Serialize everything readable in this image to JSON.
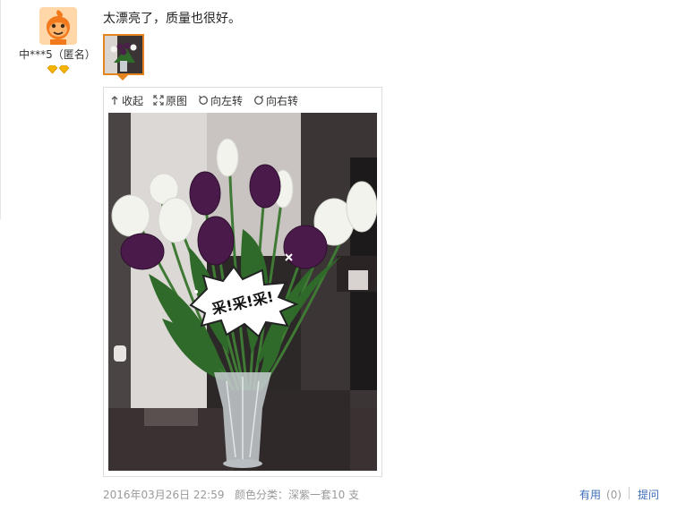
{
  "reviewer": {
    "name": "中***5（匿名）",
    "avatar_icon": "cartoon-face-icon",
    "level_badge_icon": "diamond-badge-icon"
  },
  "review": {
    "text": "太漂亮了，质量也很好。",
    "date": "2016年03月26日 22:59",
    "sku": "颜色分类：深紫一套10 支"
  },
  "viewer": {
    "collapse_label": "收起",
    "original_label": "原图",
    "rotate_left_label": "向左转",
    "rotate_right_label": "向右转",
    "sticker_text": "采!采!采!"
  },
  "actions": {
    "useful_label": "有用",
    "useful_count": "(0)",
    "ask_label": "提问"
  },
  "colors": {
    "accent_orange": "#e4841e",
    "link_blue": "#3d6db8",
    "meta_gray": "#999999"
  }
}
